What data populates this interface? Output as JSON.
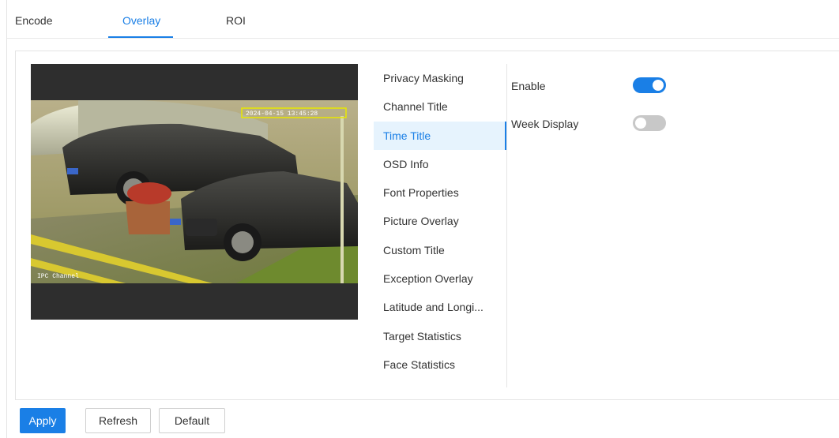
{
  "tabs": [
    {
      "label": "Encode",
      "active": false
    },
    {
      "label": "Overlay",
      "active": true
    },
    {
      "label": "ROI",
      "active": false
    }
  ],
  "preview": {
    "osd_time_text": "2024-04-15 13:45:28",
    "osd_channel_text": "IPC Channel",
    "plate_text": "京"
  },
  "side_menu": {
    "items": [
      {
        "label": "Privacy Masking",
        "active": false
      },
      {
        "label": "Channel Title",
        "active": false
      },
      {
        "label": "Time Title",
        "active": true
      },
      {
        "label": "OSD Info",
        "active": false
      },
      {
        "label": "Font Properties",
        "active": false
      },
      {
        "label": "Picture Overlay",
        "active": false
      },
      {
        "label": "Custom Title",
        "active": false
      },
      {
        "label": "Exception Overlay",
        "active": false
      },
      {
        "label": "Latitude and Longi...",
        "active": false
      },
      {
        "label": "Target Statistics",
        "active": false
      },
      {
        "label": "Face Statistics",
        "active": false
      }
    ]
  },
  "settings": {
    "enable": {
      "label": "Enable",
      "on": true
    },
    "week_display": {
      "label": "Week Display",
      "on": false
    }
  },
  "buttons": {
    "apply": "Apply",
    "refresh": "Refresh",
    "default": "Default"
  },
  "colors": {
    "accent": "#1a7fe6",
    "toggle_off": "#c8c8c8",
    "active_menu_bg": "#e6f3fd",
    "osd_box": "#e8e800"
  }
}
